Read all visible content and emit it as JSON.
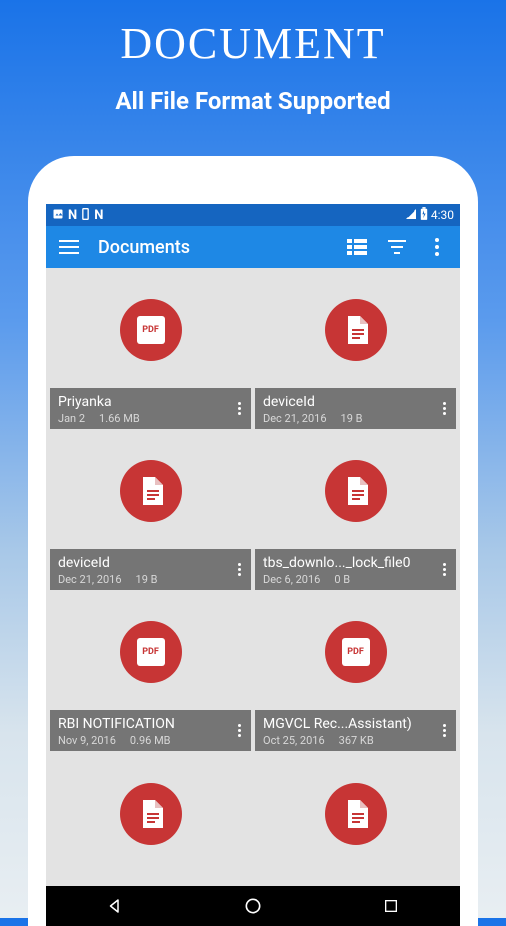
{
  "promo": {
    "title": "DOCUMENT",
    "subtitle": "All File Format Supported"
  },
  "statusBar": {
    "time": "4:30"
  },
  "appBar": {
    "title": "Documents"
  },
  "files": [
    {
      "name": "Priyanka",
      "date": "Jan 2",
      "size": "1.66 MB",
      "icon": "pdf"
    },
    {
      "name": "deviceId",
      "date": "Dec 21, 2016",
      "size": "19 B",
      "icon": "doc"
    },
    {
      "name": "deviceId",
      "date": "Dec 21, 2016",
      "size": "19 B",
      "icon": "doc"
    },
    {
      "name": "tbs_downlo..._lock_file0",
      "date": "Dec 6, 2016",
      "size": "0 B",
      "icon": "doc"
    },
    {
      "name": "RBI NOTIFICATION",
      "date": "Nov 9, 2016",
      "size": "0.96 MB",
      "icon": "pdf"
    },
    {
      "name": "MGVCL Rec...Assistant)",
      "date": "Oct 25, 2016",
      "size": "367 KB",
      "icon": "pdf"
    },
    {
      "name": "",
      "date": "",
      "size": "",
      "icon": "doc"
    },
    {
      "name": "",
      "date": "",
      "size": "",
      "icon": "doc"
    }
  ],
  "iconLabels": {
    "pdf": "PDF"
  }
}
